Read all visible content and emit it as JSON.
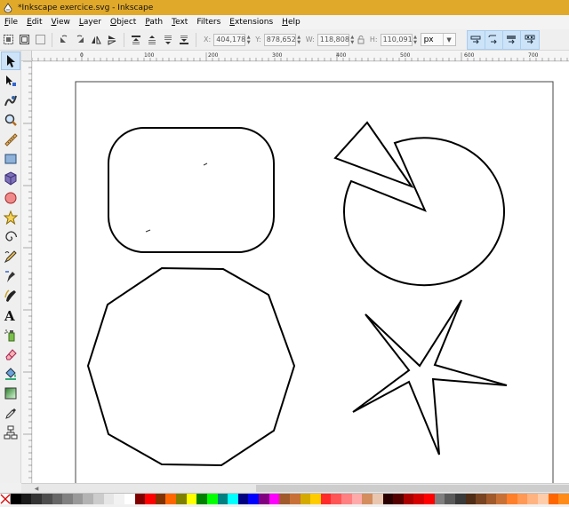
{
  "window": {
    "title": "*Inkscape exercice.svg - Inkscape"
  },
  "menu": [
    {
      "label": "File",
      "acc": "F",
      "rest": "ile"
    },
    {
      "label": "Edit",
      "acc": "E",
      "rest": "dit"
    },
    {
      "label": "View",
      "acc": "V",
      "rest": "iew"
    },
    {
      "label": "Layer",
      "acc": "L",
      "rest": "ayer"
    },
    {
      "label": "Object",
      "acc": "O",
      "rest": "bject"
    },
    {
      "label": "Path",
      "acc": "P",
      "rest": "ath"
    },
    {
      "label": "Text",
      "acc": "T",
      "rest": "ext"
    },
    {
      "label": "Filters",
      "acc": "",
      "rest": "Filters"
    },
    {
      "label": "Extensions",
      "acc": "E",
      "rest": "xtensions"
    },
    {
      "label": "Help",
      "acc": "H",
      "rest": "elp"
    }
  ],
  "toolbar": {
    "x_label": "X:",
    "x_value": "404,178",
    "y_label": "Y:",
    "y_value": "878,652",
    "w_label": "W:",
    "w_value": "118,808",
    "h_label": "H:",
    "h_value": "110,091",
    "unit": "px"
  },
  "ruler": {
    "labels": [
      "0",
      "100",
      "200",
      "300",
      "400",
      "500",
      "600",
      "700"
    ]
  },
  "palette": [
    "#000000",
    "#1a1a1a",
    "#333333",
    "#4d4d4d",
    "#666666",
    "#808080",
    "#999999",
    "#b3b3b3",
    "#cccccc",
    "#e6e6e6",
    "#f2f2f2",
    "#ffffff",
    "#800000",
    "#ff0000",
    "#803300",
    "#ff6600",
    "#808000",
    "#ffff00",
    "#008000",
    "#00ff00",
    "#008080",
    "#00ffff",
    "#000080",
    "#0000ff",
    "#800080",
    "#ff00ff",
    "#a05a2c",
    "#c87137",
    "#d4aa00",
    "#ffcc00",
    "#ff2a2a",
    "#ff5555",
    "#ff8080",
    "#ffaaaa",
    "#d38d5f",
    "#e9c6af",
    "#2b0000",
    "#550000",
    "#aa0000",
    "#d40000",
    "#ff0000",
    "#7f7f7f",
    "#5a5a5a",
    "#3a3a3a",
    "#502d16",
    "#784421",
    "#a05a2c",
    "#c87137",
    "#ff7f2a",
    "#ff9955",
    "#ffb380",
    "#ffccaa",
    "#ff6600",
    "#ff8c1a"
  ]
}
